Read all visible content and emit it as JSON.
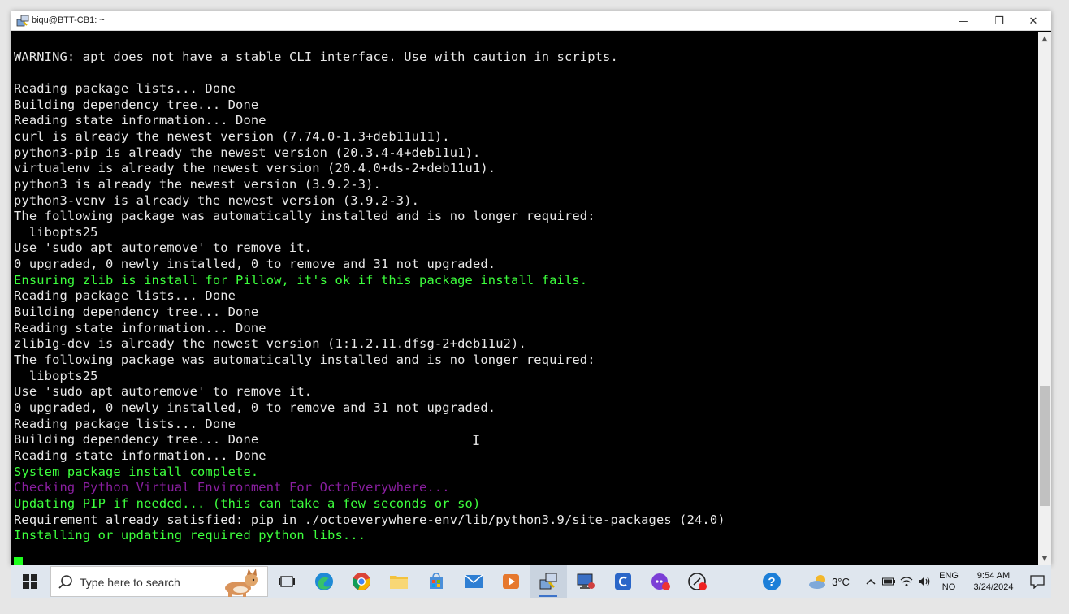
{
  "window": {
    "title": "biqu@BTT-CB1: ~",
    "minimize_glyph": "—",
    "restore_glyph": "❐",
    "close_glyph": "✕"
  },
  "terminal": {
    "lines": [
      {
        "text": "",
        "color": "white"
      },
      {
        "text": "WARNING: apt does not have a stable CLI interface. Use with caution in scripts.",
        "color": "white"
      },
      {
        "text": "",
        "color": "white"
      },
      {
        "text": "Reading package lists... Done",
        "color": "white"
      },
      {
        "text": "Building dependency tree... Done",
        "color": "white"
      },
      {
        "text": "Reading state information... Done",
        "color": "white"
      },
      {
        "text": "curl is already the newest version (7.74.0-1.3+deb11u11).",
        "color": "white"
      },
      {
        "text": "python3-pip is already the newest version (20.3.4-4+deb11u1).",
        "color": "white"
      },
      {
        "text": "virtualenv is already the newest version (20.4.0+ds-2+deb11u1).",
        "color": "white"
      },
      {
        "text": "python3 is already the newest version (3.9.2-3).",
        "color": "white"
      },
      {
        "text": "python3-venv is already the newest version (3.9.2-3).",
        "color": "white"
      },
      {
        "text": "The following package was automatically installed and is no longer required:",
        "color": "white"
      },
      {
        "text": "  libopts25",
        "color": "white"
      },
      {
        "text": "Use 'sudo apt autoremove' to remove it.",
        "color": "white"
      },
      {
        "text": "0 upgraded, 0 newly installed, 0 to remove and 31 not upgraded.",
        "color": "white"
      },
      {
        "text": "Ensuring zlib is install for Pillow, it's ok if this package install fails.",
        "color": "green"
      },
      {
        "text": "Reading package lists... Done",
        "color": "white"
      },
      {
        "text": "Building dependency tree... Done",
        "color": "white"
      },
      {
        "text": "Reading state information... Done",
        "color": "white"
      },
      {
        "text": "zlib1g-dev is already the newest version (1:1.2.11.dfsg-2+deb11u2).",
        "color": "white"
      },
      {
        "text": "The following package was automatically installed and is no longer required:",
        "color": "white"
      },
      {
        "text": "  libopts25",
        "color": "white"
      },
      {
        "text": "Use 'sudo apt autoremove' to remove it.",
        "color": "white"
      },
      {
        "text": "0 upgraded, 0 newly installed, 0 to remove and 31 not upgraded.",
        "color": "white"
      },
      {
        "text": "Reading package lists... Done",
        "color": "white"
      },
      {
        "text": "Building dependency tree... Done",
        "color": "white"
      },
      {
        "text": "Reading state information... Done",
        "color": "white"
      },
      {
        "text": "System package install complete.",
        "color": "green"
      },
      {
        "text": "Checking Python Virtual Environment For OctoEverywhere...",
        "color": "purple"
      },
      {
        "text": "Updating PIP if needed... (this can take a few seconds or so)",
        "color": "green"
      },
      {
        "text": "Requirement already satisfied: pip in ./octoeverywhere-env/lib/python3.9/site-packages (24.0)",
        "color": "white"
      },
      {
        "text": "Installing or updating required python libs...",
        "color": "green"
      }
    ]
  },
  "scrollbar": {
    "up_glyph": "▲",
    "down_glyph": "▼",
    "position_fraction": 0.88
  },
  "taskbar": {
    "search_placeholder": "Type here to search",
    "apps": [
      {
        "name": "task-view-icon",
        "active": false
      },
      {
        "name": "edge-icon",
        "active": false
      },
      {
        "name": "chrome-icon",
        "active": false
      },
      {
        "name": "file-explorer-icon",
        "active": false
      },
      {
        "name": "microsoft-store-icon",
        "active": false
      },
      {
        "name": "mail-icon",
        "active": false
      },
      {
        "name": "media-player-icon",
        "active": false
      },
      {
        "name": "putty-icon",
        "active": true
      },
      {
        "name": "remote-desktop-icon",
        "active": false
      },
      {
        "name": "c-app-icon",
        "active": false
      },
      {
        "name": "chat-app-icon",
        "active": false
      },
      {
        "name": "record-app-icon",
        "active": false
      }
    ],
    "tray": {
      "help_glyph": "?",
      "temperature": "3°C",
      "language_top": "ENG",
      "language_bottom": "NO",
      "time": "9:54 AM",
      "date": "3/24/2024"
    }
  },
  "colors": {
    "terminal_bg": "#000000",
    "terminal_text": "#e8e8e8",
    "green_text": "#3dff3d",
    "purple_text": "#8a1fa0",
    "taskbar_bg": "#dfe6ee"
  }
}
